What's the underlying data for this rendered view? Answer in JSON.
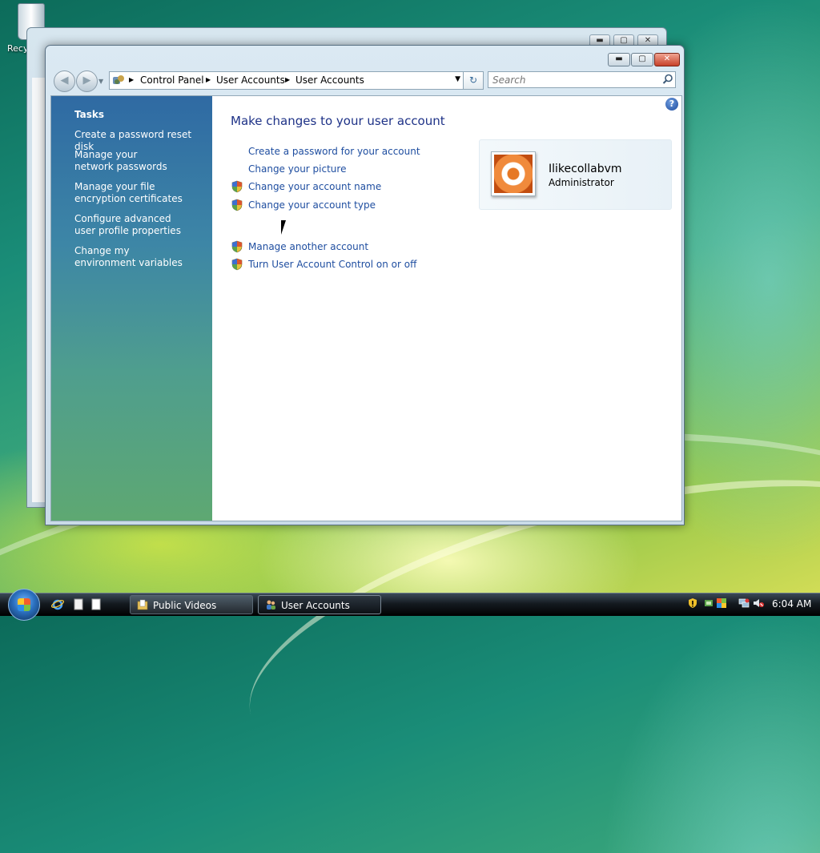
{
  "desktop": {
    "recycle_label": "Recy"
  },
  "window": {
    "controls": {
      "minimize": "▬",
      "maximize": "▢",
      "close": "✕"
    },
    "nav": {
      "back": "◀",
      "forward": "▶",
      "dropdown": "▼"
    },
    "address": {
      "crumbs": [
        "Control Panel",
        "User Accounts",
        "User Accounts"
      ],
      "separator": "▶",
      "dropdown": "▼",
      "refresh": "↻"
    },
    "search": {
      "placeholder": "Search"
    },
    "help": "?"
  },
  "sidebar": {
    "title": "Tasks",
    "items": [
      {
        "label": "Create a password reset disk"
      },
      {
        "label": "Manage your network passwords"
      },
      {
        "label": "Manage your file encryption certificates"
      },
      {
        "label": "Configure advanced user profile properties"
      },
      {
        "label": "Change my environment variables"
      }
    ]
  },
  "main": {
    "heading": "Make changes to your user account",
    "links": [
      {
        "label": "Create a password for your account",
        "shield": false
      },
      {
        "label": "Change your picture",
        "shield": false
      },
      {
        "label": "Change your account name",
        "shield": true
      },
      {
        "label": "Change your account type",
        "shield": true
      },
      {
        "label": "Manage another account",
        "shield": true
      },
      {
        "label": "Turn User Account Control on or off",
        "shield": true
      }
    ]
  },
  "user": {
    "name": "Ilikecollabvm",
    "role": "Administrator"
  },
  "taskbar": {
    "buttons": [
      {
        "label": "Public Videos",
        "active": false
      },
      {
        "label": "User Accounts",
        "active": true
      }
    ],
    "clock": "6:04 AM"
  }
}
